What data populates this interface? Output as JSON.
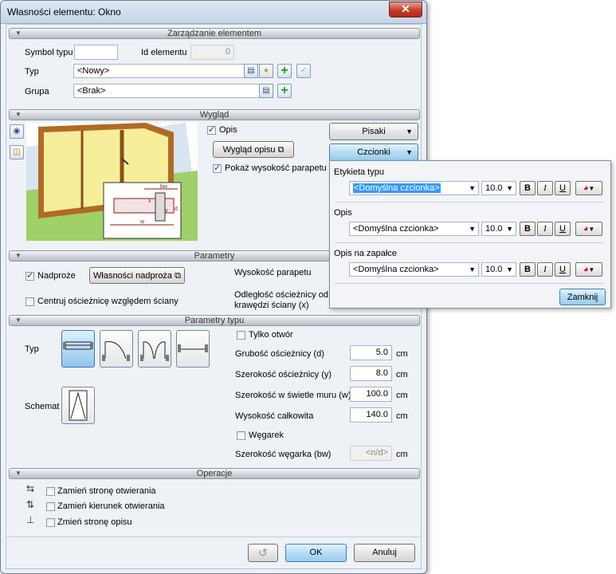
{
  "window": {
    "title": "Własności elementu: Okno",
    "close_glyph": "✕"
  },
  "sections": {
    "management": "Zarządzanie elementem",
    "appearance": "Wygląd",
    "parameters": "Parametry",
    "type_parameters": "Parametry typu",
    "operations": "Operacje"
  },
  "management": {
    "symbol_label": "Symbol typu",
    "symbol_value": "",
    "id_label": "Id elementu",
    "id_value": "0",
    "type_label": "Typ",
    "type_value": "<Nowy>",
    "group_label": "Grupa",
    "group_value": "<Brak>"
  },
  "appearance": {
    "opis_label": "Opis",
    "opis_checked": true,
    "wyglad_opisu_label": "Wygląd opisu",
    "show_parapet_label": "Pokaż wysokość parapetu",
    "show_parapet_checked": true,
    "pisaki_label": "Pisaki",
    "czcionki_label": "Czcionki",
    "diagram_labels": {
      "bw": "bw",
      "x": "x",
      "d": "d",
      "y": "y",
      "w": "w"
    }
  },
  "parameters": {
    "lintel_label": "Nadproże",
    "lintel_checked": true,
    "lintel_props_label": "Własności nadproża",
    "parapet_height_label": "Wysokość parapetu",
    "frame_distance_label_1": "Odległość ościeżnicy od",
    "frame_distance_label_2": "krawędzi ściany (x)",
    "center_frame_label": "Centruj ościeżnicę względem ściany",
    "center_frame_checked": false
  },
  "type_parameters": {
    "typ_label": "Typ",
    "schemat_label": "Schemat",
    "only_opening_label": "Tylko otwór",
    "only_opening_checked": false,
    "rows": [
      {
        "label": "Grubość ościeżnicy (d)",
        "value": "5.0",
        "unit": "cm"
      },
      {
        "label": "Szerokość ościeżnicy (y)",
        "value": "8.0",
        "unit": "cm"
      },
      {
        "label": "Szerokość w świetle muru (w)",
        "value": "100.0",
        "unit": "cm"
      },
      {
        "label": "Wysokość całkowita",
        "value": "140.0",
        "unit": "cm"
      }
    ],
    "wegarek_label": "Węgarek",
    "wegarek_checked": false,
    "wegarek_width_label": "Szerokość węgarka (bw)",
    "wegarek_width_value": "<n/d>",
    "wegarek_unit": "cm"
  },
  "operations": {
    "items": [
      {
        "label": "Zamień stronę otwierania",
        "checked": false
      },
      {
        "label": "Zamień kierunek otwierania",
        "checked": false
      },
      {
        "label": "Zmień stronę opisu",
        "checked": false
      }
    ]
  },
  "footer": {
    "ok_label": "OK",
    "cancel_label": "Anuluj"
  },
  "fonts_popup": {
    "groups": [
      {
        "label": "Etykieta typu",
        "font": "<Domyślna czcionka>",
        "size": "10.0"
      },
      {
        "label": "Opis",
        "font": "<Domyślna czcionka>",
        "size": "10.0"
      },
      {
        "label": "Opis na zapałce",
        "font": "<Domyślna czcionka>",
        "size": "10.0"
      }
    ],
    "bold": "B",
    "italic": "I",
    "underline": "U",
    "close_label": "Zamknij"
  },
  "colors": {
    "accent": "#3c7fb1",
    "selection": "#3399ff",
    "window_bg": "#eef2f7"
  }
}
